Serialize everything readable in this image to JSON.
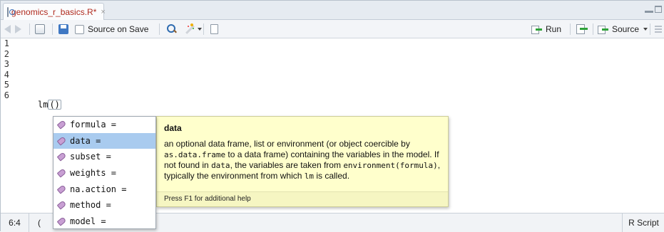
{
  "tab": {
    "title": "genomics_r_basics.R*",
    "close": "×"
  },
  "toolbar": {
    "source_on_save_label": "Source on Save",
    "run_label": "Run",
    "source_label": "Source"
  },
  "editor": {
    "line_numbers": [
      "1",
      "2",
      "3",
      "4",
      "5",
      "6"
    ],
    "code_line_6": "lm",
    "cursor_paren": "()"
  },
  "completion": {
    "items": [
      "formula =",
      "data =",
      "subset =",
      "weights =",
      "na.action =",
      "method =",
      "model ="
    ],
    "selected_index": 1
  },
  "help": {
    "title": "data",
    "body": {
      "t1": "an optional data frame, list or environment (or object coercible by ",
      "c1": "as.data.frame",
      "t2": " to a data frame) containing the variables in the model. If not found in ",
      "c2": "data",
      "t3": ", the variables are taken from ",
      "c3": "environment(formula)",
      "t4": ", typically the environment from which ",
      "c4": "lm",
      "t5": " is called."
    },
    "footer": "Press F1 for additional help"
  },
  "status": {
    "position": "6:4",
    "scope": "(",
    "file_type": "R Script"
  }
}
